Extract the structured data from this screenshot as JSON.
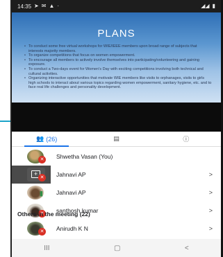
{
  "status": {
    "time": "14:35"
  },
  "slide": {
    "title": "PLANS",
    "bullets": [
      "To conduct some free virtual workshops for WIE/IEEE members upon broad range of subjects that interests majority members.",
      "To organize competitions that focus on women empowerment.",
      "To encourage all members to actively involve themselves into participating/volunteering and gaining exposure.",
      "To conduct a Two-days event for Women's Day with exciting competitions involving both technical and cultural activities.",
      "Organizing interactive opportunities that motivate WIE members like visits to orphanages, visits to girls high schools to interact about various topics regarding women empowerment, sanitary hygiene, etc. and to face real life challenges and personality development."
    ]
  },
  "tabs": {
    "people_count": "(26)"
  },
  "participants": [
    {
      "name": "Shwetha Vasan (You)",
      "muted": true,
      "chevron": ""
    },
    {
      "name": "Jahnavi AP",
      "muted": true,
      "chevron": ">"
    },
    {
      "name": "Jahnavi AP",
      "muted": false,
      "chevron": ">"
    },
    {
      "name": "santhosh kumar",
      "muted": true,
      "chevron": ">"
    }
  ],
  "others": {
    "label": "Others in the meeting (22)",
    "first": {
      "name": "Anirudh K N",
      "chevron": ">"
    }
  },
  "nav": {
    "recent": "III",
    "home": "▢",
    "back": "<"
  }
}
